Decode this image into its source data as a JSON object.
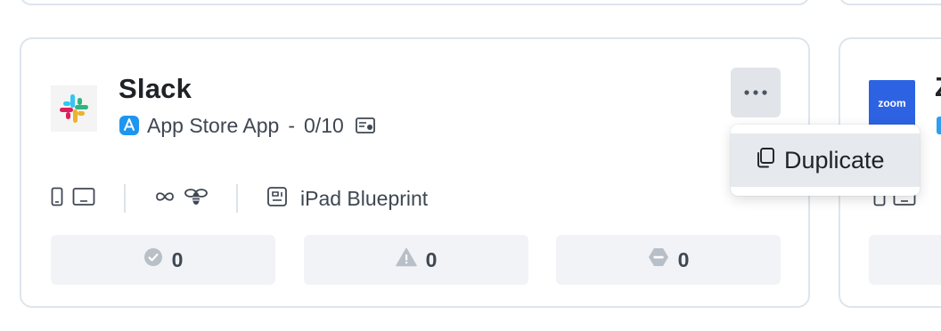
{
  "cards": {
    "main": {
      "app_name": "Slack",
      "app_type": "App Store App",
      "separator": "-",
      "progress_text": "0/10",
      "blueprint": "iPad Blueprint",
      "stats": [
        {
          "icon": "check-circle-icon",
          "value": "0"
        },
        {
          "icon": "warning-triangle-icon",
          "value": "0"
        },
        {
          "icon": "blocked-icon",
          "value": "0"
        }
      ],
      "menu": {
        "button_icon": "ellipsis-icon",
        "items": [
          {
            "icon": "copy-icon",
            "label": "Duplicate"
          }
        ]
      }
    },
    "partial_right": {
      "logo_text": "zoom",
      "name_fragment": "Z"
    }
  },
  "colors": {
    "card_border": "#dde5ec",
    "stat_bg": "#f1f3f6",
    "more_button_bg": "#e1e5ea",
    "appstore_blue": "#1e96f0",
    "zoom_blue": "#2d63e2"
  }
}
